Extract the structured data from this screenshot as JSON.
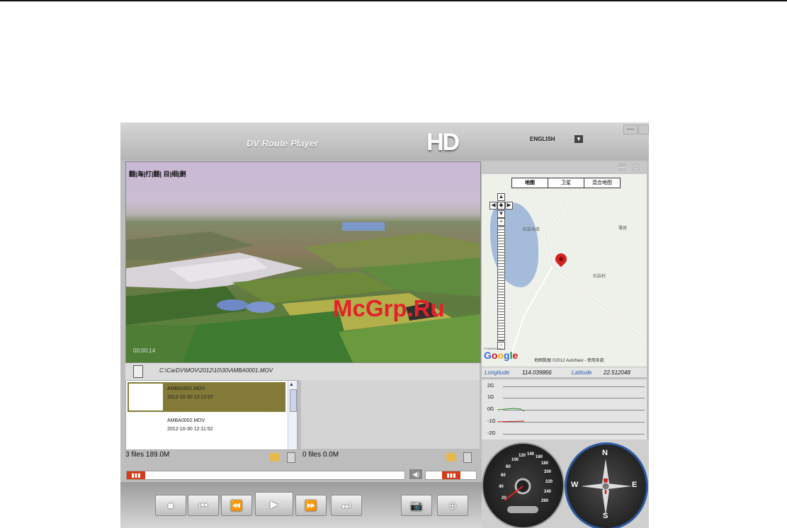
{
  "window": {
    "title": "DV Route Player",
    "logo": "HD",
    "language": "ENGLISH",
    "minimize": "—"
  },
  "video": {
    "osd_top": "翻|海|打|翻| 目|细|删",
    "osd_bottom": "00:00:14",
    "watermark": "McGrp.Ru",
    "file_path": "C:\\CarDV\\MOV\\2012\\10\\30\\AMBA0001.MOV"
  },
  "playlist": {
    "files": [
      {
        "name": "AMBA0001.MOV",
        "time": "2012-10-30  12:12:07",
        "selected": true
      },
      {
        "name": "AMBA0002.MOV",
        "time": "2012-10-30  12:11:52",
        "selected": false
      }
    ],
    "left_count": "3 files 189.0M",
    "right_count": "0 files 0.0M",
    "scroll_up": "▲"
  },
  "transport": {
    "progress_knob": "▮▮▮",
    "volume_knob": "▮▮▮",
    "volume_icon": "◀)",
    "progress_level": 0.0,
    "volume_level": 0.5,
    "buttons": {
      "stop": "■",
      "prev": "⏮",
      "rewind": "⏪",
      "play": "▶",
      "forward": "⏩",
      "next": "⏭",
      "snapshot": "📷",
      "zoom": "⊕"
    }
  },
  "map": {
    "tabs": [
      "地图",
      "卫星",
      "混合地图"
    ],
    "controls": {
      "min": "—",
      "max": "□"
    },
    "zoom_in": "+",
    "zoom_out": "−",
    "labels": [
      "石岩水库",
      "雅居",
      "石岩村"
    ],
    "provider": "Google",
    "powered": "POWERED BY",
    "copyright": "地图数据 ©2012 AutoNavi - 使用条款"
  },
  "gps": {
    "longitude_label": "Longitude",
    "longitude": "114.039866",
    "latitude_label": "Latitude",
    "latitude": "22.512048"
  },
  "gsensor": {
    "ticks": [
      "2G",
      "1G",
      "0G",
      "-1G",
      "-2G"
    ]
  },
  "speedometer": {
    "scale": [
      "20",
      "40",
      "60",
      "80",
      "100",
      "120",
      "140",
      "160",
      "180",
      "200",
      "220",
      "240",
      "260"
    ]
  },
  "compass": {
    "north": "N",
    "south": "S",
    "east": "E",
    "west": "W"
  },
  "colors": {
    "selected_row": "#837a38",
    "accent_red": "#d43b16",
    "compass_ring": "#2c5aa0",
    "map_water": "#a4bcd9"
  }
}
